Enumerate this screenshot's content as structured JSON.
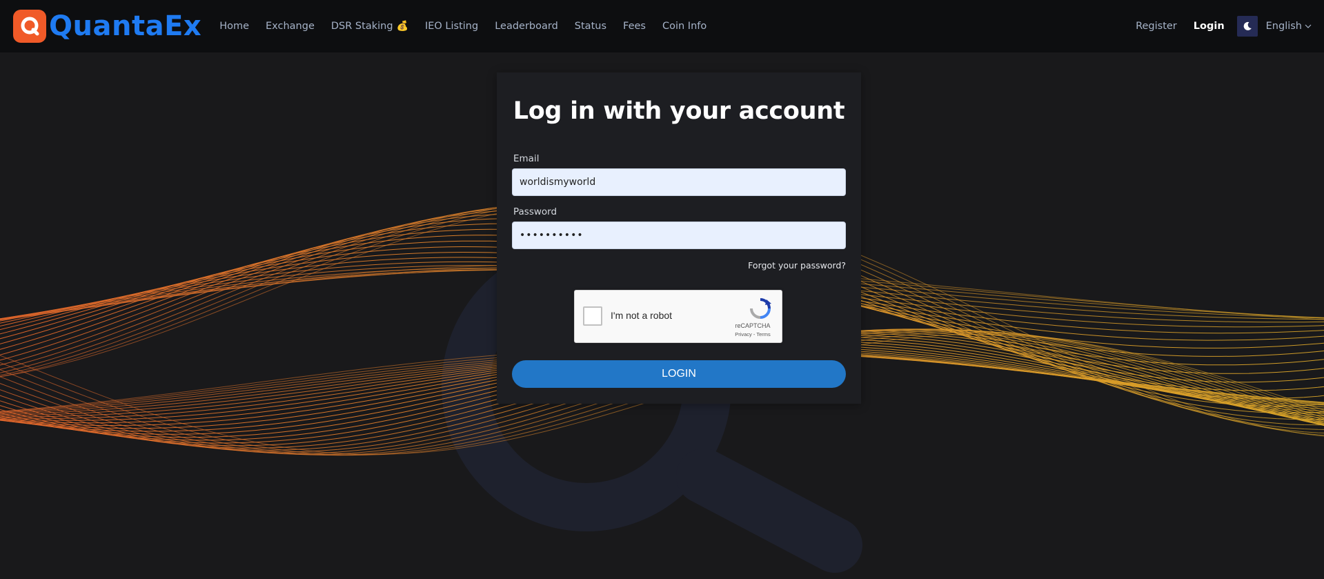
{
  "brand": {
    "name": "QuantaEx",
    "logo_color": "#f05a28",
    "text_color": "#1f7bf2"
  },
  "nav": {
    "items": [
      {
        "label": "Home"
      },
      {
        "label": "Exchange"
      },
      {
        "label": "DSR Staking",
        "emoji": "💰"
      },
      {
        "label": "IEO Listing"
      },
      {
        "label": "Leaderboard"
      },
      {
        "label": "Status"
      },
      {
        "label": "Fees"
      },
      {
        "label": "Coin Info"
      }
    ],
    "register": "Register",
    "login": "Login",
    "theme_icon": "moon-icon",
    "language": "English"
  },
  "login_form": {
    "title": "Log in with your account",
    "email_label": "Email",
    "email_value": "worldismyworld",
    "password_label": "Password",
    "password_value": "••••••••••",
    "forgot_label": "Forgot your password?",
    "submit_label": "LOGIN",
    "button_color": "#2277c7"
  },
  "recaptcha": {
    "label": "I'm not a robot",
    "brand": "reCAPTCHA",
    "links": "Privacy - Terms"
  },
  "colors": {
    "background": "#19191b",
    "card": "#1d1e22",
    "wave_orange": "#e0642a",
    "wave_yellow": "#d9a528"
  }
}
